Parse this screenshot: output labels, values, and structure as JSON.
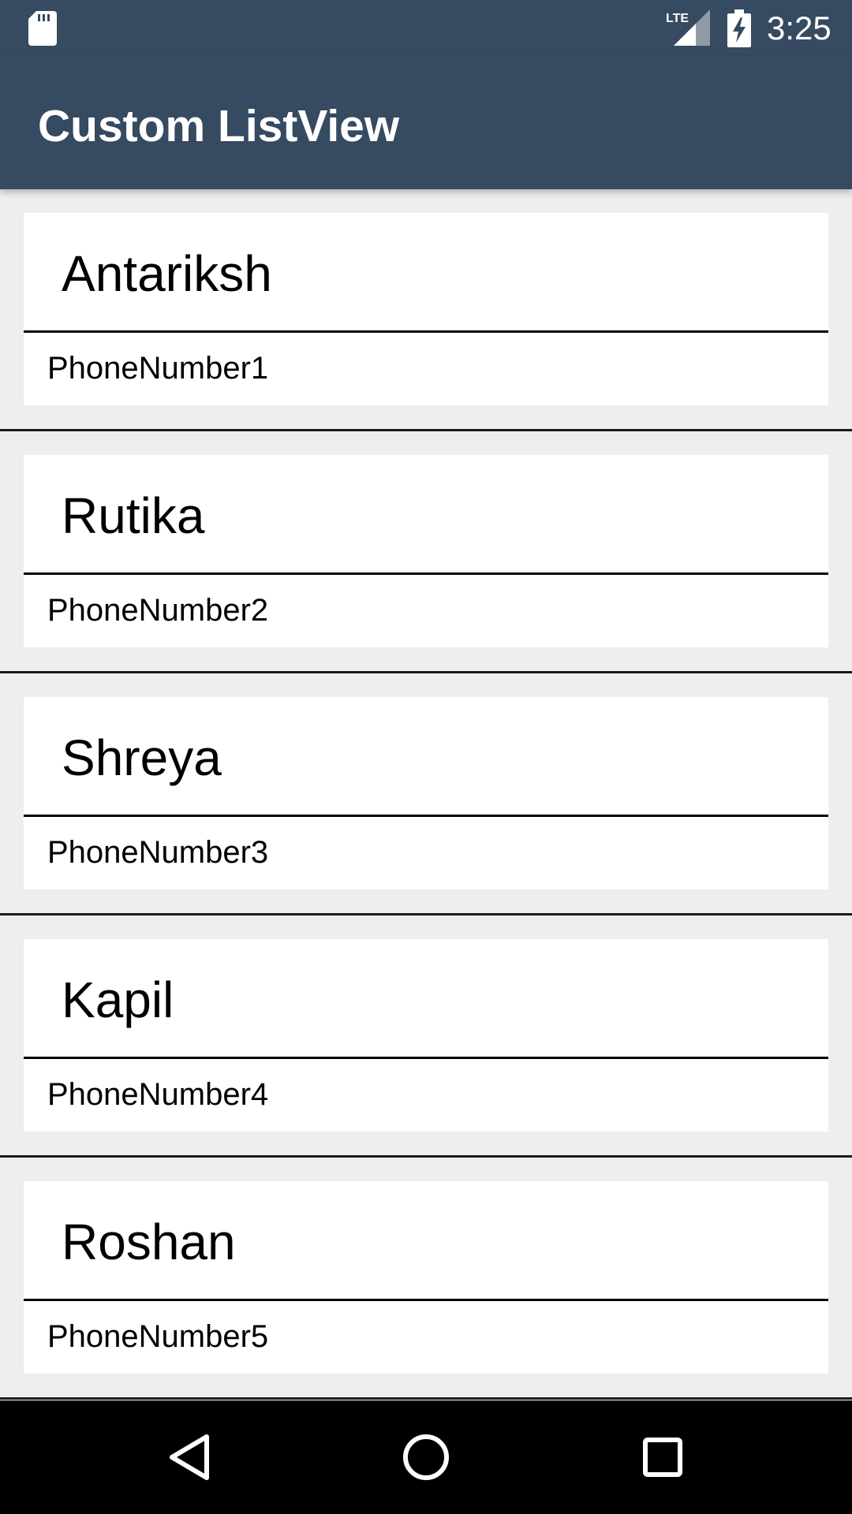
{
  "status_bar": {
    "time": "3:25",
    "network_label": "LTE",
    "icons": [
      "sd-card-icon",
      "lte-signal-icon",
      "battery-charging-icon"
    ]
  },
  "app_bar": {
    "title": "Custom ListView",
    "color": "#364a61"
  },
  "contacts": [
    {
      "name": "Antariksh",
      "phone": "PhoneNumber1"
    },
    {
      "name": "Rutika",
      "phone": "PhoneNumber2"
    },
    {
      "name": "Shreya",
      "phone": "PhoneNumber3"
    },
    {
      "name": "Kapil",
      "phone": "PhoneNumber4"
    },
    {
      "name": "Roshan",
      "phone": "PhoneNumber5"
    }
  ],
  "nav_bar": {
    "buttons": [
      "back-icon",
      "home-icon",
      "recents-icon"
    ]
  }
}
